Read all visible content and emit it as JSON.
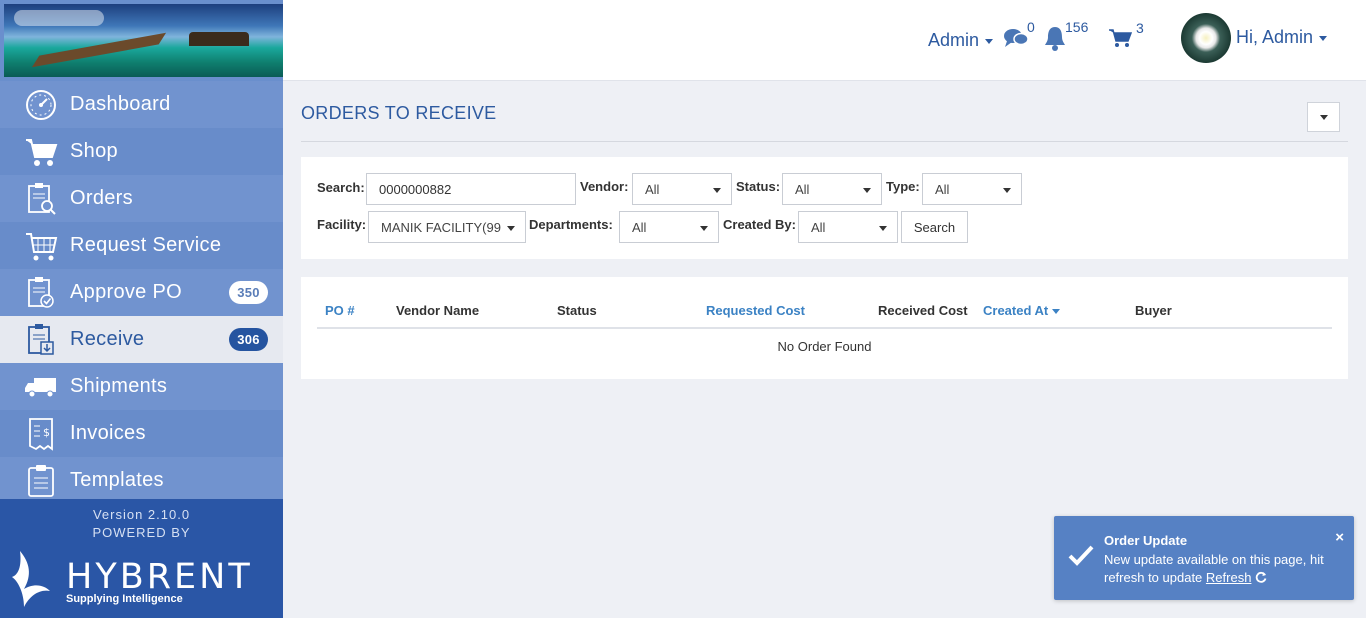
{
  "sidebar": {
    "items": [
      {
        "label": "Dashboard",
        "icon": "dashboard-gauge-icon"
      },
      {
        "label": "Shop",
        "icon": "shopping-cart-icon"
      },
      {
        "label": "Orders",
        "icon": "orders-clipboard-search-icon"
      },
      {
        "label": "Request Service",
        "icon": "request-service-cart-icon"
      },
      {
        "label": "Approve PO",
        "icon": "approve-clipboard-check-icon",
        "badge": "350"
      },
      {
        "label": "Receive",
        "icon": "receive-clipboard-download-icon",
        "badge": "306",
        "active": true
      },
      {
        "label": "Shipments",
        "icon": "truck-icon"
      },
      {
        "label": "Invoices",
        "icon": "invoice-dollar-icon"
      },
      {
        "label": "Templates",
        "icon": "templates-clipboard-icon"
      }
    ],
    "version": "Version 2.10.0",
    "powered_by": "POWERED BY",
    "brand_name": "HYBRENT",
    "brand_tagline": "Supplying Intelligence"
  },
  "header": {
    "admin_label": "Admin",
    "messages_count": "0",
    "notifications_count": "156",
    "cart_count": "3",
    "greeting": "Hi, Admin"
  },
  "page": {
    "title": "ORDERS TO RECEIVE"
  },
  "filters": {
    "search_label": "Search:",
    "search_value": "0000000882",
    "vendor_label": "Vendor:",
    "vendor_value": "All",
    "status_label": "Status:",
    "status_value": "All",
    "type_label": "Type:",
    "type_value": "All",
    "facility_label": "Facility:",
    "facility_value": "MANIK FACILITY(99",
    "departments_label": "Departments:",
    "departments_value": "All",
    "created_by_label": "Created By:",
    "created_by_value": "All",
    "search_button": "Search"
  },
  "table": {
    "columns": [
      "PO #",
      "Vendor Name",
      "Status",
      "Requested Cost",
      "Received Cost",
      "Created At",
      "Buyer"
    ],
    "empty_message": "No Order Found"
  },
  "toast": {
    "title": "Order Update",
    "message": "New update available on this page, hit refresh to update",
    "link": "Refresh",
    "close": "×"
  },
  "colors": {
    "sidebar": "#6a8fcd",
    "sidebar_footer": "#2a56a6",
    "accent": "#2d5aa0",
    "link": "#3b82c4",
    "toast": "#5681c4"
  }
}
